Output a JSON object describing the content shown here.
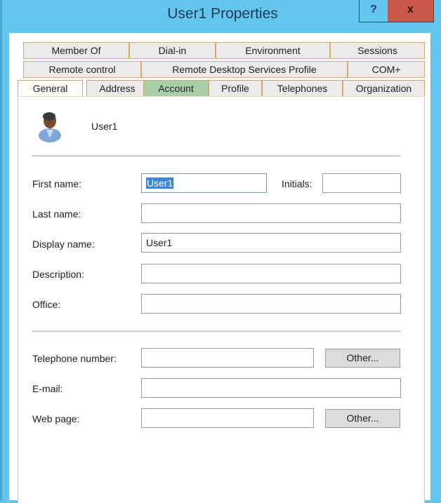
{
  "window": {
    "title": "User1 Properties",
    "help_label": "?",
    "close_label": "x"
  },
  "tabs": {
    "row1": [
      "Member Of",
      "Dial-in",
      "Environment",
      "Sessions"
    ],
    "row2": [
      "Remote control",
      "Remote Desktop Services Profile",
      "COM+"
    ],
    "row3": [
      "General",
      "Address",
      "Account",
      "Profile",
      "Telephones",
      "Organization"
    ],
    "active": "General",
    "highlighted": "Account"
  },
  "general": {
    "object_name": "User1",
    "first_name_label": "First name:",
    "first_name_value": "User1",
    "initials_label": "Initials:",
    "initials_value": "",
    "last_name_label": "Last name:",
    "last_name_value": "",
    "display_name_label": "Display name:",
    "display_name_value": "User1",
    "description_label": "Description:",
    "description_value": "",
    "office_label": "Office:",
    "office_value": "",
    "telephone_label": "Telephone number:",
    "telephone_value": "",
    "telephone_other_label": "Other...",
    "email_label": "E-mail:",
    "email_value": "",
    "webpage_label": "Web page:",
    "webpage_value": "",
    "webpage_other_label": "Other..."
  },
  "colors": {
    "titlebar": "#63c6ec",
    "close_button": "#c9574a",
    "tab_border": "#d8a86a",
    "highlight_tab": "#a8d0a8",
    "selection": "#3b86d6"
  }
}
